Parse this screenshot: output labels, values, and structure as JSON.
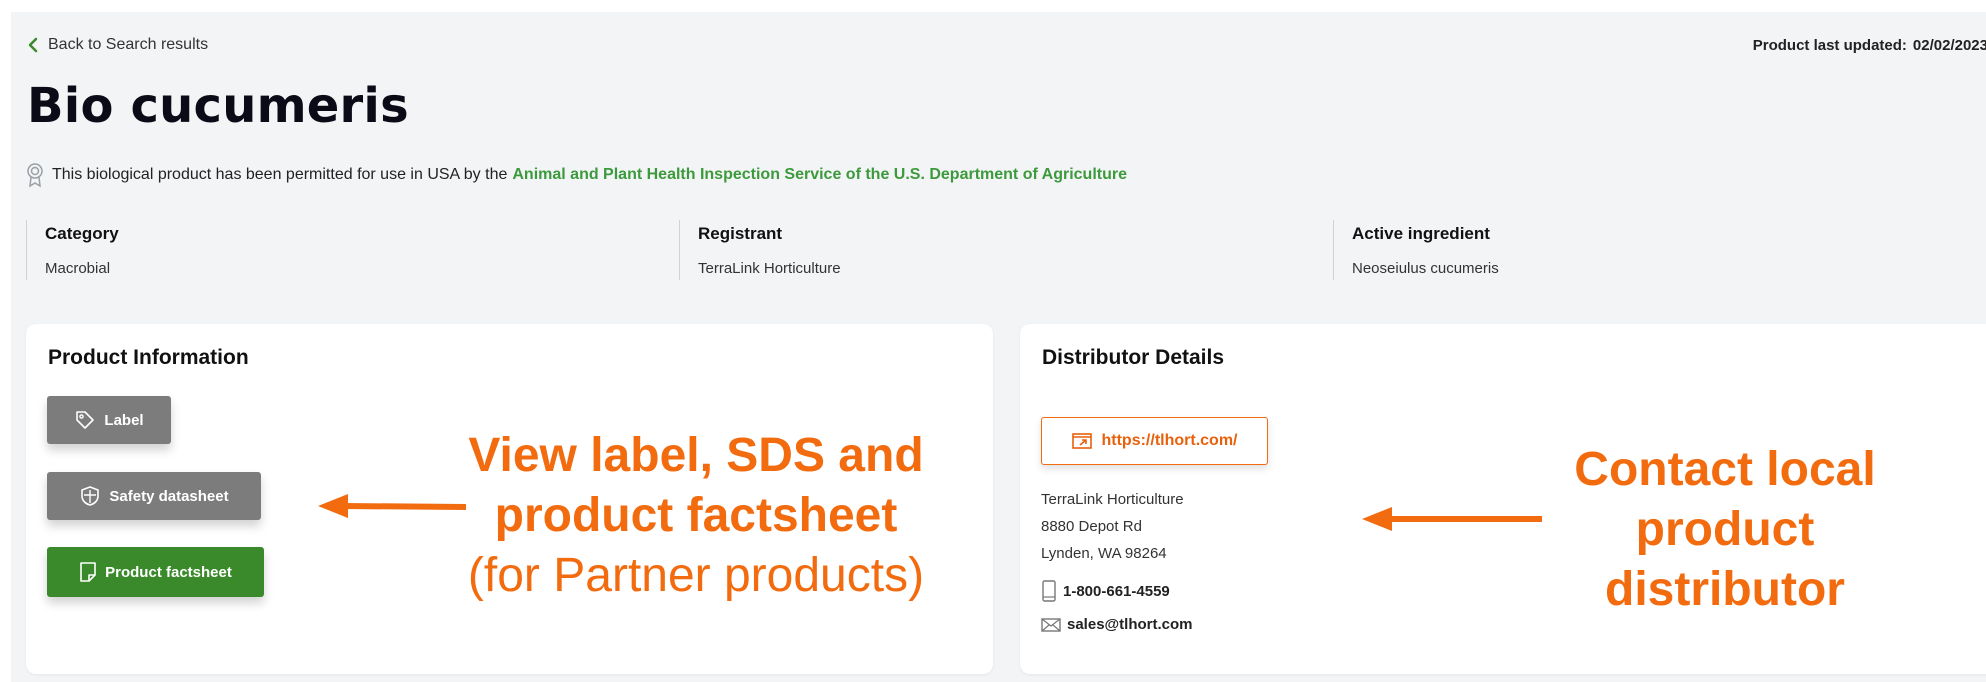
{
  "nav": {
    "back_label": "Back to Search results"
  },
  "last_updated": {
    "label": "Product last updated:",
    "date": "02/02/2023"
  },
  "product": {
    "title": "Bio cucumeris"
  },
  "permit": {
    "text": "This biological product has been permitted for use in USA by the",
    "agency_link": "Animal and Plant Health Inspection Service of the U.S. Department of Agriculture"
  },
  "meta": [
    {
      "key": "Category",
      "value": "Macrobial"
    },
    {
      "key": "Registrant",
      "value": "TerraLink Horticulture"
    },
    {
      "key": "Active ingredient",
      "value": "Neoseiulus cucumeris"
    }
  ],
  "product_info": {
    "heading": "Product Information",
    "buttons": [
      {
        "label": "Label",
        "icon": "tag-icon"
      },
      {
        "label": "Safety datasheet",
        "icon": "shield-icon"
      },
      {
        "label": "Product factsheet",
        "icon": "document-icon"
      }
    ]
  },
  "distributor": {
    "heading": "Distributor Details",
    "url": "https://tlhort.com/",
    "address": [
      "TerraLink Horticulture",
      "8880 Depot Rd",
      "Lynden, WA 98264"
    ],
    "phone": "1-800-661-4559",
    "email": "sales@tlhort.com"
  },
  "annotations": {
    "left": {
      "line1": "View label, SDS and",
      "line2": "product factsheet",
      "line3": "(for Partner products)"
    },
    "right": {
      "line1": "Contact local",
      "line2": "product",
      "line3": "distributor"
    }
  },
  "colors": {
    "accent_green": "#3a8a2b",
    "link_green": "#3c9a3c",
    "annotation_orange": "#f26b0f",
    "button_gray": "#7c7c7c"
  }
}
